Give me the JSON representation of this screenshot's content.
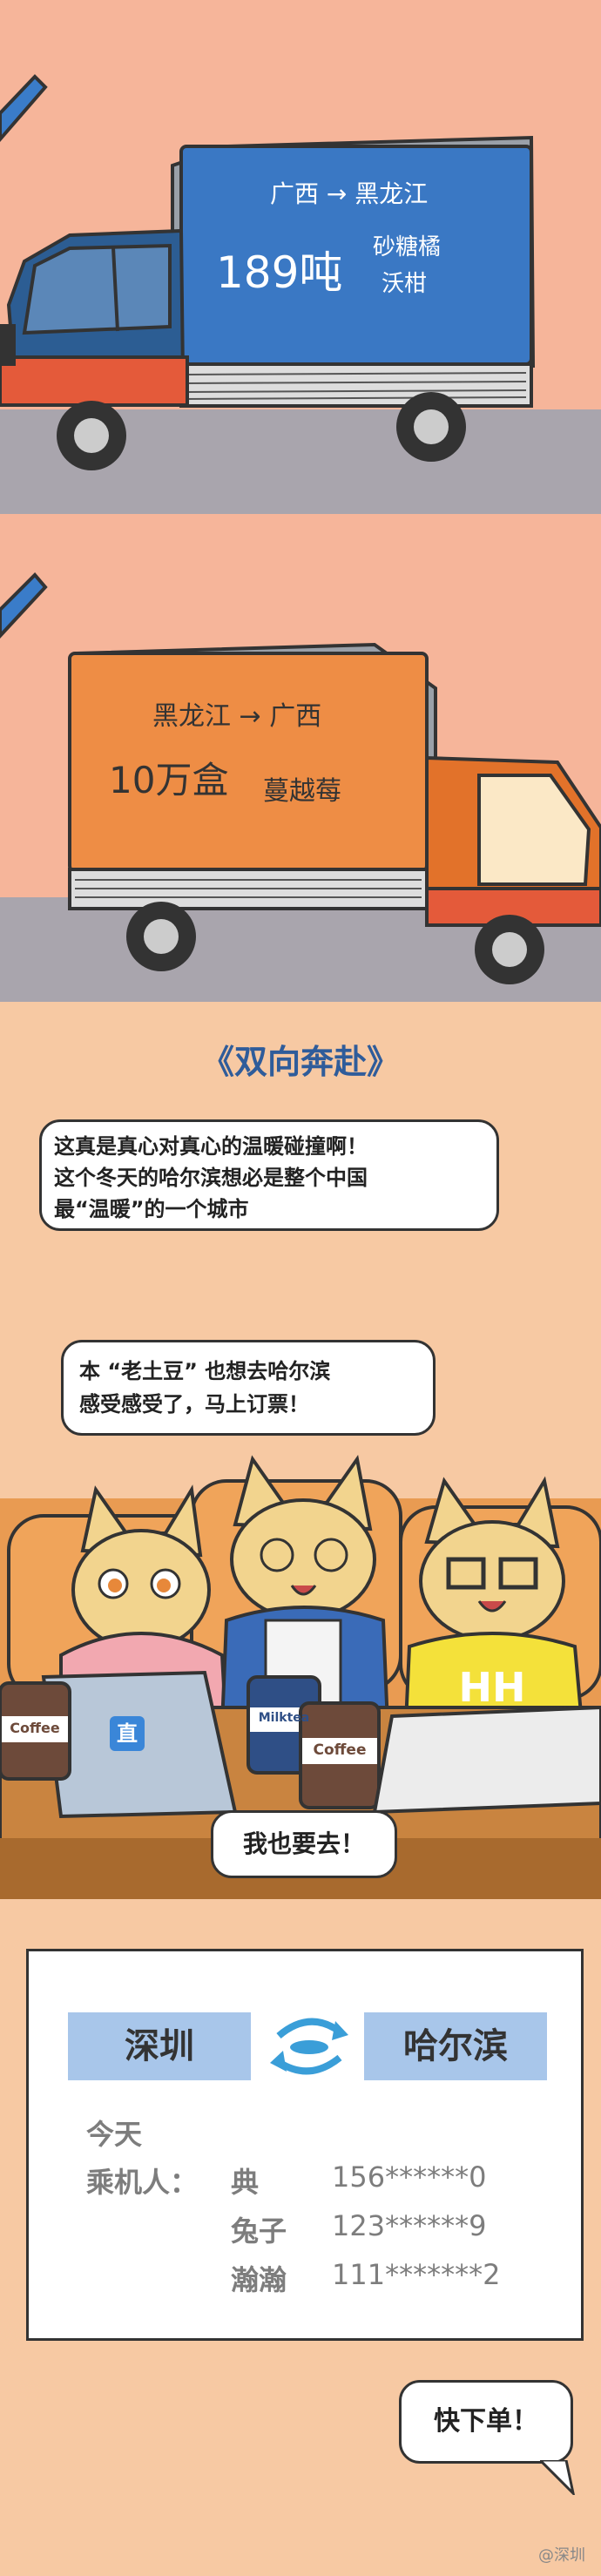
{
  "panel1": {
    "route": "广西 → 黑龙江",
    "amount": "189吨",
    "cargo_line1": "砂糖橘",
    "cargo_line2": "沃柑"
  },
  "panel2": {
    "route": "黑龙江 → 广西",
    "amount": "10万盒",
    "cargo": "蔓越莓"
  },
  "caption": "《双向奔赴》",
  "bubbles": {
    "one_line1": "这真是真心对真心的温暖碰撞啊！",
    "one_line2": "这个冬天的哈尔滨想必是整个中国",
    "one_line3": "最“温暖”的一个城市",
    "two_line1": "本 “老土豆” 也想去哈尔滨",
    "two_line2": "感受感受了，马上订票！",
    "three": "我也要去！",
    "four": "快下单！"
  },
  "laptop_badge": "直",
  "cup_label1": "Coffee",
  "cup_label2": "Milktea",
  "cup_label3": "Coffee",
  "shirt_text": "HH",
  "ticket": {
    "from": "深圳",
    "to": "哈尔滨",
    "day": "今天",
    "passenger_label": "乘机人：",
    "passengers": [
      {
        "name": "典",
        "phone": "156******0"
      },
      {
        "name": "兔子",
        "phone": "123******9"
      },
      {
        "name": "瀚瀚",
        "phone": "111*******2"
      }
    ]
  },
  "watermark": "@深圳"
}
